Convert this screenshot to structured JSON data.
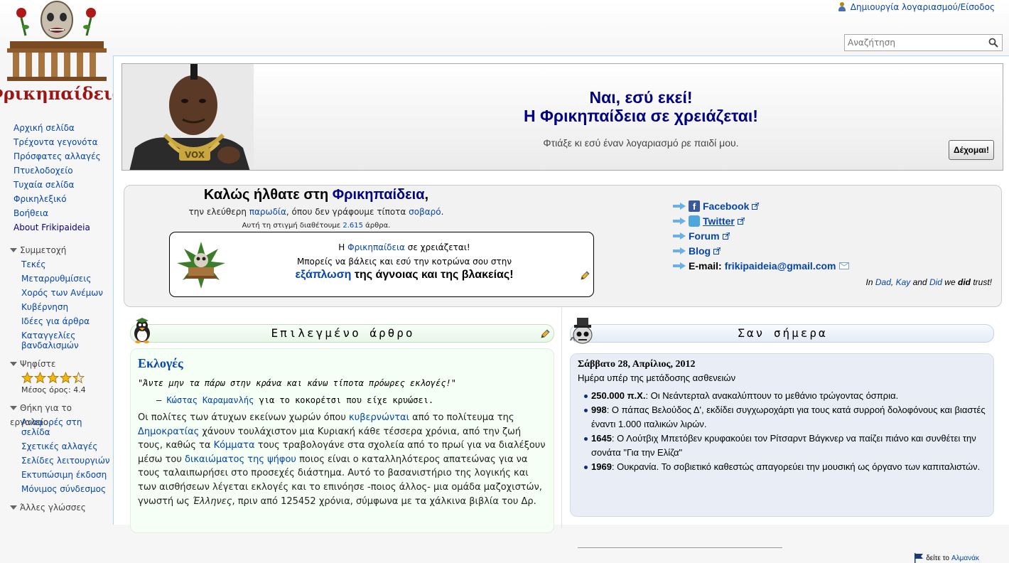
{
  "header": {
    "account_link": "Δημιουργία λογαριασμού/Είσοδος",
    "search_placeholder": "Αναζήτηση"
  },
  "logo": {
    "text": "Φρικηπαίδεια"
  },
  "sidebar": {
    "nav": [
      "Αρχική σελίδα",
      "Τρέχοντα γεγονότα",
      "Πρόσφατες αλλαγές",
      "Πτυελοδοχείο",
      "Τυχαία σελίδα",
      "Φρικηλεξικό",
      "Βοήθεια",
      "About Frikipaideia"
    ],
    "participation": {
      "heading": "Συμμετοχή",
      "items": [
        "Τεκές",
        "Μεταρρυθμίσεις",
        "Χορός των Ανέμων",
        "Κυβέρνηση",
        "Ιδέες για άρθρα",
        "Καταγγελίες βανδαλισμών"
      ]
    },
    "rating": {
      "heading": "Ψηφίστε",
      "value": 4.4,
      "max": 5,
      "average_text": "Μέσος όρος: 4.4"
    },
    "toolbox": {
      "heading": "Θήκη για το εργαλείο",
      "items": [
        "Αναφορές στη σελίδα",
        "Σχετικές αλλαγές",
        "Σελίδες λειτουργιών",
        "Εκτυπώσιμη έκδοση",
        "Μόνιμος σύνδεσμος"
      ]
    },
    "languages": {
      "heading": "Άλλες γλώσσες"
    }
  },
  "banner": {
    "line1": "Ναι, εσύ εκεί!",
    "line2": "Η Φρικηπαίδεια σε χρειάζεται!",
    "subtitle": "Φτιάξε κι εσύ έναν λογαριασμό ρε παιδί μου.",
    "accept_button": "Δέχομαι!",
    "chain_text": "VOX"
  },
  "welcome": {
    "title_prefix": "Καλώς ήλθατε στη ",
    "title_brand": "Φρικηπαίδεια",
    "title_suffix": ",",
    "sub_prefix": "την ελεύθερη ",
    "sub_link1": "παρωδία",
    "sub_mid": ", όπου δεν γράφουμε τίποτα ",
    "sub_link2": "σοβαρό",
    "sub_suffix": ".",
    "count_prefix": "Αυτή τη στιγμή διαθέτουμε ",
    "count_value": "2.615",
    "count_suffix": " άρθρα.",
    "help_l1_link": "Φρικηπαίδεια",
    "help_l1_prefix": "Η ",
    "help_l1_suffix": " σε χρειάζεται!",
    "help_l2": "Μπορείς να βάλεις και εσύ την κοτρώνα σου στην",
    "help_l3_link": "εξάπλωση",
    "help_l3_suffix": " της άγνοιας και της βλακείας!",
    "social": {
      "facebook": "Facebook",
      "twitter": "Twitter",
      "forum": "Forum",
      "blog": "Blog",
      "email_label": "E-mail:",
      "email": "frikipaideia@gmail.com"
    },
    "trust": {
      "in": "In ",
      "dad": "Dad",
      "sep1": ", ",
      "kay": "Kay",
      "and": " and ",
      "did": "Did",
      "we": " we ",
      "did2": "did",
      "end": " trust!"
    }
  },
  "featured": {
    "heading": "Επιλεγμένο άρθρο",
    "article_title": "Εκλογές",
    "quote": "\"Άντε μην τα πάρω στην κράνα και κάνω τίποτα πρόωρες εκλογές!\"",
    "attrib_dash": "– ",
    "attrib_name": "Κώστας Καραμανλής",
    "attrib_rest": " για το κοκορέτσι που είχε κρυώσει.",
    "body": [
      {
        "t": "Οι πολίτες των άτυχων εκείνων χωρών όπου "
      },
      {
        "l": "κυβερνώνται"
      },
      {
        "t": " από το πολίτευμα της "
      },
      {
        "l": "Δημοκρατίας"
      },
      {
        "t": " χάνουν τουλάχιστον μια Κυριακή κάθε τέσσερα χρόνια, από την ζωή τους, καθώς τα "
      },
      {
        "l": "Κόμματα"
      },
      {
        "t": " τους τραβολογάνε στα σχολεία από το πρωί για να διαλέξουν μέσω του "
      },
      {
        "l": "δικαιώματος της ψήφου"
      },
      {
        "t": " ποιος είναι ο καταλληλότερος απατεώνας για να τους ταλαιπωρήσει στο προσεχές διάστημα. Αυτό το βασανιστήριο της λογικής και των αισθήσεων λέγεται εκλογές και το επινόησε -ποιος άλλος- μια ομάδα μαζοχιστών, γνωστή ως "
      },
      {
        "i": "Έλληνες"
      },
      {
        "t": ", πριν από 125452 χρόνια, σύμφωνα με τα χάλκινα βιβλία του Δρ."
      }
    ]
  },
  "onthisday": {
    "heading": "Σαν σήμερα",
    "date": "Σάββατο 28, Απρίλιος, 2012",
    "day_name": "Ημέρα υπέρ της μετάδοσης ασθενειών",
    "events": [
      {
        "year": "250.000 π.Χ.",
        "text": ": Οι Νεάντερταλ ανακαλύπτουν το μεθάνιο τρώγοντας όσπρια."
      },
      {
        "year": "998",
        "text": ": Ο πάπας Βελούδος Δ', εκδίδει συγχωροχάρτι για τους κατά συρροή δολοφόνους και βιαστές έναντι 1.000 ιταλικών λιρών."
      },
      {
        "year": "1645",
        "text": ": Ο Λούτβιχ Μπετόβεν κρυφακούει τον Ρίτσαρντ Βάγκνερ να παίζει πιάνο και συνθέτει την σονάτα \"Για την Ελίζα\""
      },
      {
        "year": "1969",
        "text": ": Ουκρανία. Το σοβιετικό καθεστώς απαγορεύει την μουσική ως όργανο των καπιταλιστών."
      }
    ],
    "almanac_prefix": "δείτε το ",
    "almanac_link": "Αλμανάκ"
  },
  "colors": {
    "link": "#0645ad",
    "brand": "#000080",
    "frame": "#a7d7f9"
  }
}
